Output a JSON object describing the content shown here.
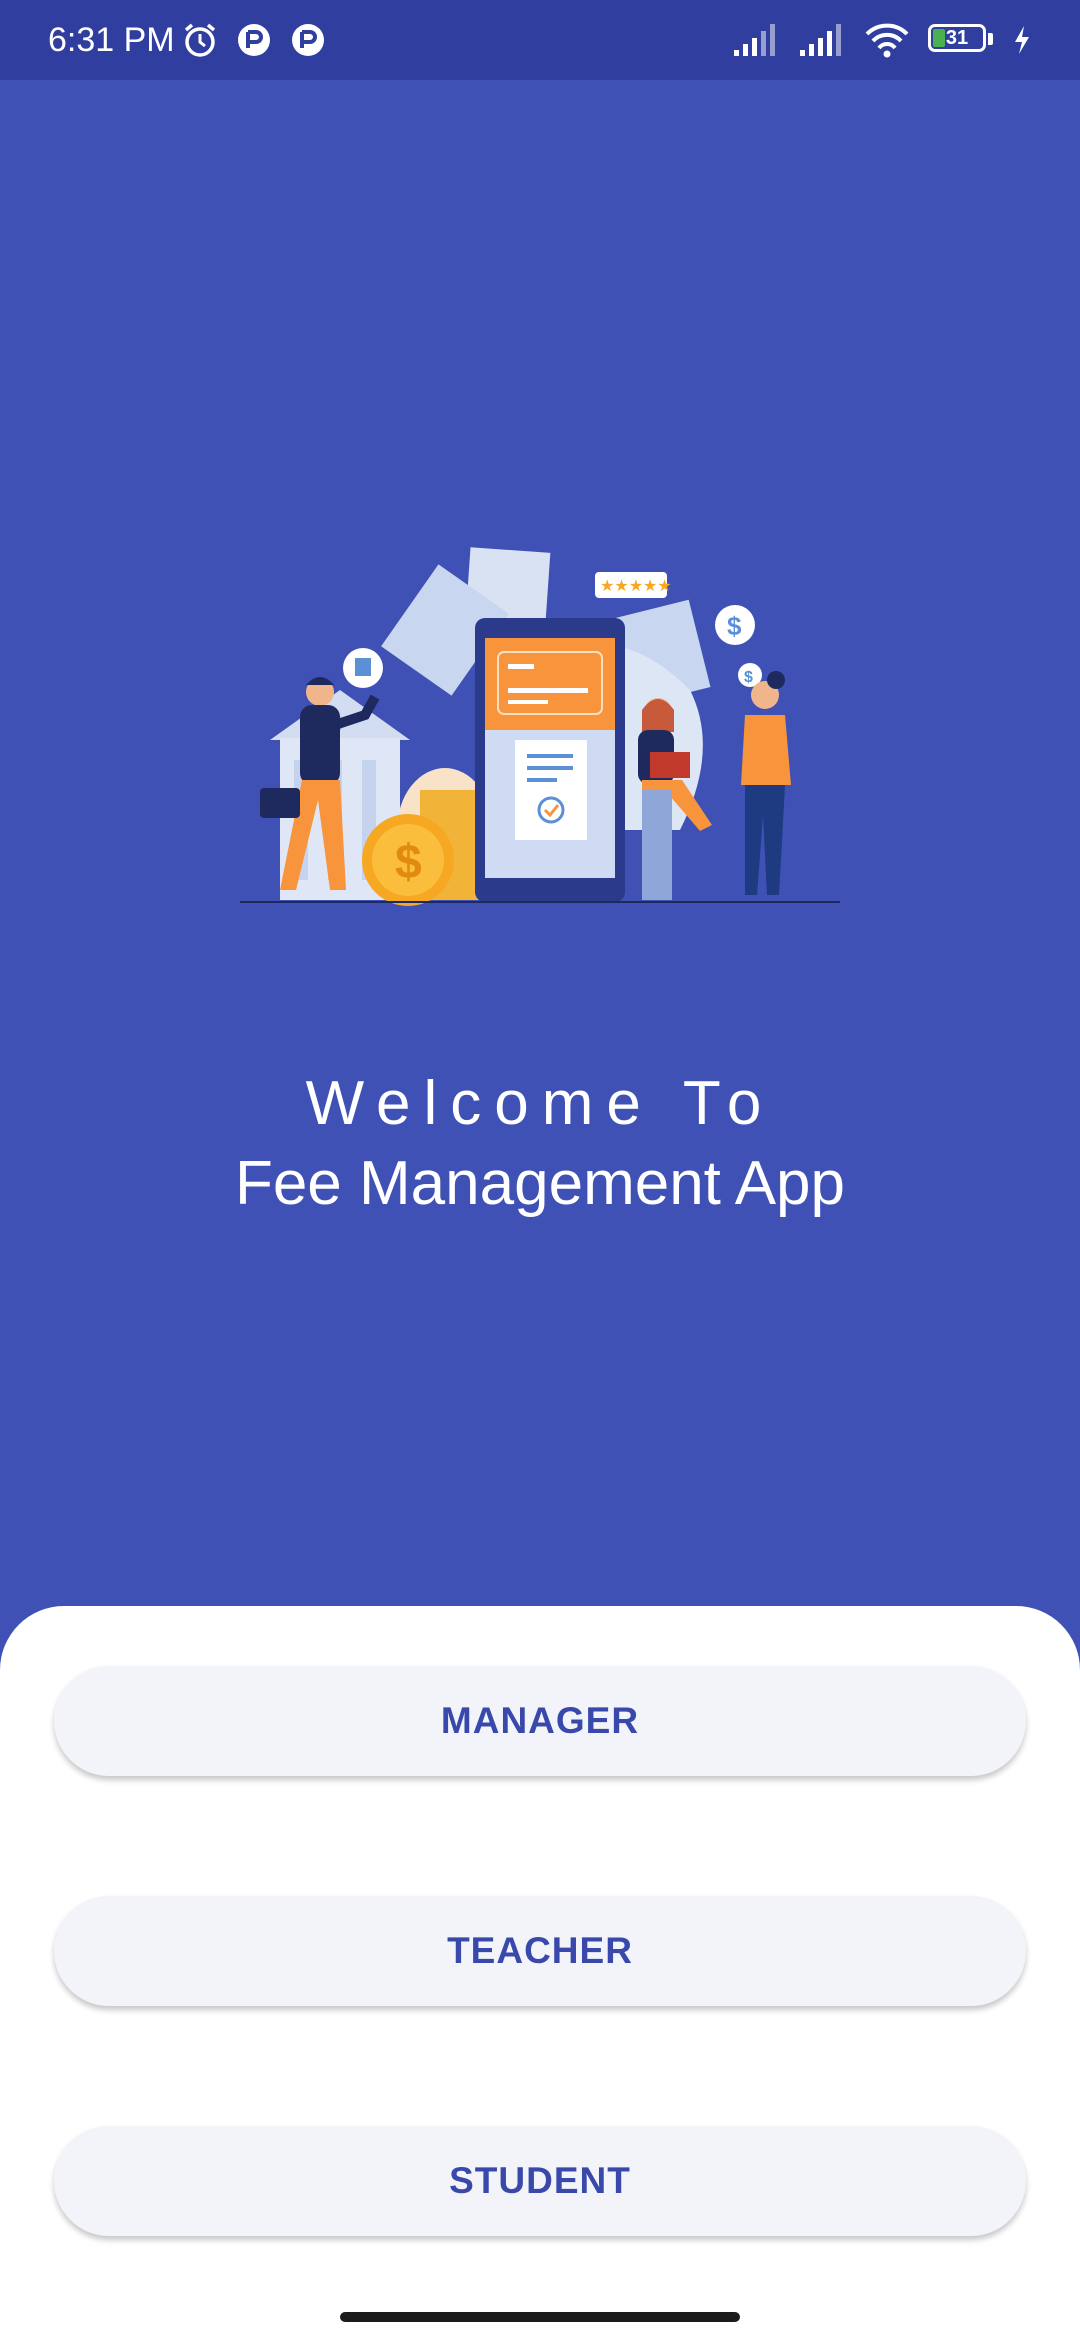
{
  "status_bar": {
    "time": "6:31 PM",
    "battery_level": "31",
    "left_icons": [
      "alarm-icon",
      "app-notification-icon",
      "app-notification-icon"
    ],
    "right_icons": [
      "signal-icon",
      "signal-icon",
      "wifi-icon",
      "battery-icon",
      "charging-icon"
    ]
  },
  "welcome": {
    "line1": "Welcome To",
    "line2": "Fee Management App"
  },
  "roles": {
    "manager": "MANAGER",
    "teacher": "TEACHER",
    "student": "STUDENT"
  },
  "colors": {
    "background": "#3f51b5",
    "status_bar": "#303f9f",
    "button_text": "#3949ab",
    "button_bg": "#f3f4f9",
    "accent_orange": "#f7943c"
  }
}
